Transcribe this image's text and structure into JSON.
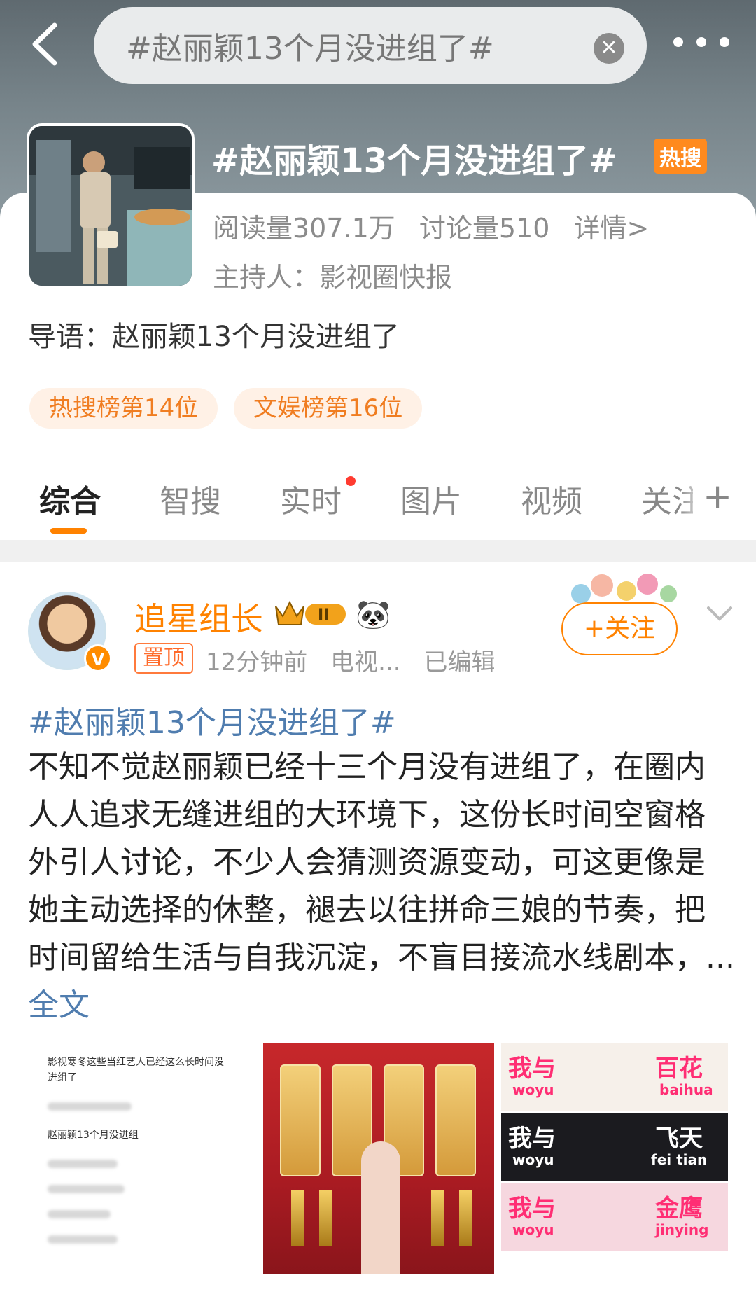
{
  "search": {
    "query": "#赵丽颖13个月没进组了#"
  },
  "topic": {
    "title": "#赵丽颖13个月没进组了#",
    "hot_badge": "热搜",
    "reads": "阅读量307.1万",
    "discussions": "讨论量510",
    "details": "详情>",
    "host": "主持人：影视圈快报",
    "intro": "导语：赵丽颖13个月没进组了",
    "ranks": [
      "热搜榜第14位",
      "文娱榜第16位"
    ]
  },
  "tabs": [
    "综合",
    "智搜",
    "实时",
    "图片",
    "视频",
    "关注"
  ],
  "tab_more": "+",
  "post": {
    "author": "追星组长",
    "level_badge": "II",
    "pinned": "置顶",
    "time": "12分钟前",
    "source": "电视...",
    "edited": "已编辑",
    "follow": "+关注",
    "hashtag": "#赵丽颖13个月没进组了#",
    "text": "不知不觉赵丽颖已经十三个月没有进组了，在圈内人人追求无缝进组的大环境下，这份长时间空窗格外引人讨论，不少人会猜测资源变动，可这更像是她主动选择的休整，褪去以往拼命三娘的节奏，把时间留给生活与自我沉淀，不盲目接流水线剧本，... ",
    "more": "全文"
  },
  "images": {
    "img1_caption": "影视寒冬这些当红艺人已经这么长时间没进组了",
    "img1_line": "赵丽颖13个月没进组",
    "img3_rows": [
      {
        "left": "我与",
        "left_pinyin": "woyu",
        "right": "百花",
        "right_pinyin": "baihua"
      },
      {
        "left": "我与",
        "left_pinyin": "woyu",
        "right": "飞天",
        "right_pinyin": "fei tian"
      },
      {
        "left": "我与",
        "left_pinyin": "woyu",
        "right": "金鹰",
        "right_pinyin": "jinying"
      }
    ]
  },
  "colors": {
    "accent": "#ff8200",
    "link": "#507daf",
    "hot": "#ff8a1e"
  }
}
